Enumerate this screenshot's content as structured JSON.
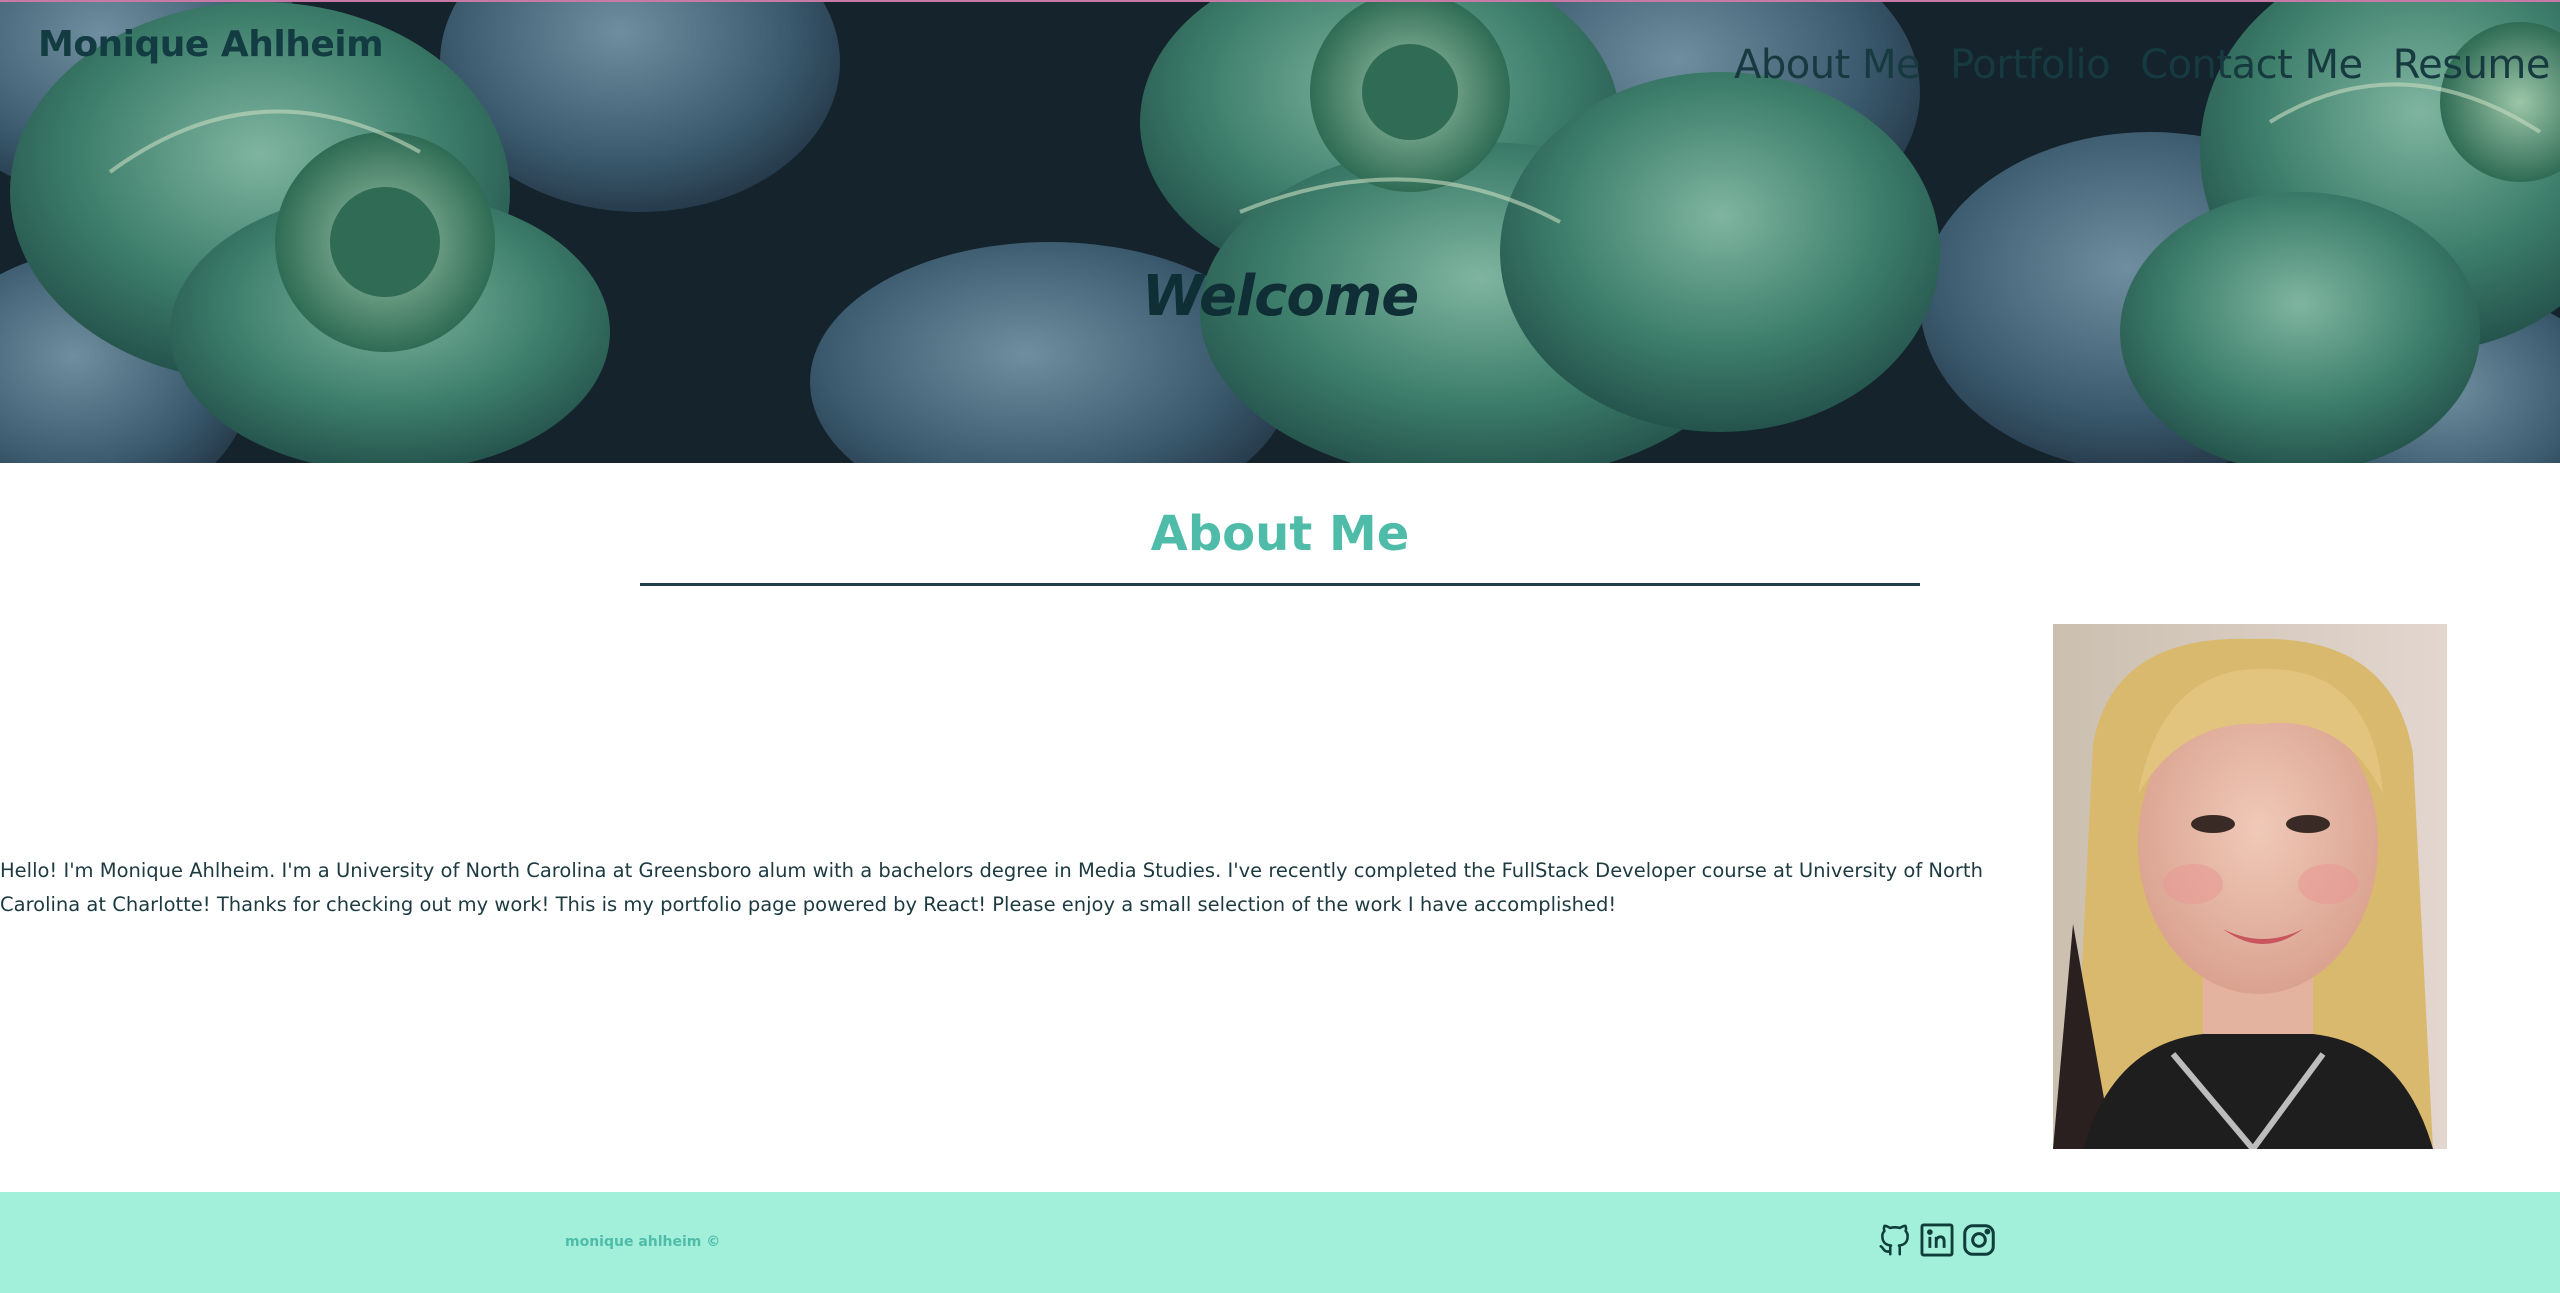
{
  "header": {
    "site_title": "Monique Ahlheim",
    "nav": [
      {
        "label": "About Me"
      },
      {
        "label": "Portfolio"
      },
      {
        "label": "Contact Me"
      },
      {
        "label": "Resume"
      }
    ],
    "hero_text": "Welcome",
    "hero_image": "succulent-plants-photo"
  },
  "about": {
    "heading": "About Me",
    "body": "Hello! I'm Monique Ahlheim. I'm a University of North Carolina at Greensboro alum with a bachelors degree in Media Studies. I've recently completed the FullStack Developer course at University of North Carolina at Charlotte! Thanks for checking out my work! This is my portfolio page powered by React! Please enjoy a small selection of the work I have accomplished!",
    "photo": "profile-photo"
  },
  "footer": {
    "copyright": "monique ahlheim ©",
    "social": [
      {
        "icon": "github-icon"
      },
      {
        "icon": "linkedin-icon"
      },
      {
        "icon": "instagram-icon"
      }
    ]
  },
  "colors": {
    "accent": "#4fbcaa",
    "footer_bg": "#a2f0da",
    "text_dark": "#1c3a40",
    "rule": "#1d3f45"
  }
}
